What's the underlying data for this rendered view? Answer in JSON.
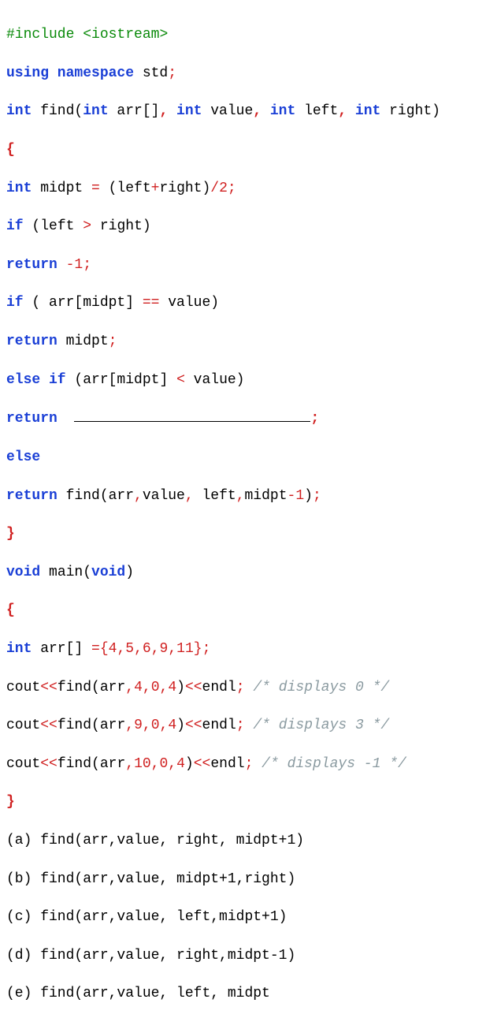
{
  "code": {
    "t01a": "#include",
    "t01b": " <iostream>",
    "t02a": "using namespace",
    "t02b": " std",
    "t02c": ";",
    "t03a": "int",
    "t03b": " find(",
    "t03c": "int",
    "t03d": " arr[]",
    "t03e": ", ",
    "t03f": "int",
    "t03g": " value",
    "t03h": ", ",
    "t03i": "int",
    "t03j": " left",
    "t03k": ", ",
    "t03l": "int",
    "t03m": " right)",
    "t04": "{",
    "t05a": "int",
    "t05b": " midpt ",
    "t05c": "=",
    "t05d": " (left",
    "t05e": "+",
    "t05f": "right)",
    "t05g": "/",
    "t05h": "2",
    "t05i": ";",
    "t06a": "if",
    "t06b": " (left ",
    "t06c": ">",
    "t06d": " right)",
    "t07a": "return",
    "t07b": " -1;",
    "t08a": "if",
    "t08b": " ( arr[midpt] ",
    "t08c": "==",
    "t08d": " value)",
    "t09a": "return",
    "t09b": " midpt",
    "t09c": ";",
    "t10a": "else if",
    "t10b": " (arr[midpt] ",
    "t10c": "<",
    "t10d": " value)",
    "t11a": "return",
    "t11b": "  ",
    "t11c": ";",
    "t12": "else",
    "t13a": "return",
    "t13b": " find(arr",
    "t13c": ",",
    "t13d": "value",
    "t13e": ",",
    "t13f": " left",
    "t13g": ",",
    "t13h": "midpt",
    "t13i": "-",
    "t13j": "1",
    "t13k": ")",
    "t13l": ";",
    "t14": "}",
    "t15a": "void",
    "t15b": " main(",
    "t15c": "void",
    "t15d": ")",
    "t16": "{",
    "t17a": "int",
    "t17b": " arr[] ",
    "t17c": "=",
    "t17d": "{",
    "t17e": "4",
    "t17f": ",",
    "t17g": "5",
    "t17h": ",",
    "t17i": "6",
    "t17j": ",",
    "t17k": "9",
    "t17l": ",",
    "t17m": "11",
    "t17n": "};",
    "t18a": "cout",
    "t18b": "<<",
    "t18c": "find(arr",
    "t18d": ",",
    "t18e": "4",
    "t18f": ",",
    "t18g": "0",
    "t18h": ",",
    "t18i": "4",
    "t18j": ")",
    "t18k": "<<",
    "t18l": "endl",
    "t18m": ";",
    "t18n": " /* displays 0 */",
    "t19a": "cout",
    "t19b": "<<",
    "t19c": "find(arr",
    "t19d": ",",
    "t19e": "9",
    "t19f": ",",
    "t19g": "0",
    "t19h": ",",
    "t19i": "4",
    "t19j": ")",
    "t19k": "<<",
    "t19l": "endl",
    "t19m": ";",
    "t19n": " /* displays 3 */",
    "t20a": "cout",
    "t20b": "<<",
    "t20c": "find(arr",
    "t20d": ",",
    "t20e": "10",
    "t20f": ",",
    "t20g": "0",
    "t20h": ",",
    "t20i": "4",
    "t20j": ")",
    "t20k": "<<",
    "t20l": "endl",
    "t20m": ";",
    "t20n": " /* displays -1 */",
    "t21": "}",
    "optA": "(a) find(arr,value, right, midpt+1)",
    "optB": "(b) find(arr,value, midpt+1,right)",
    "optC": "(c) find(arr,value, left,midpt+1)",
    "optD": "(d) find(arr,value, right,midpt-1)",
    "optE": "(e) find(arr,value, left, midpt"
  }
}
